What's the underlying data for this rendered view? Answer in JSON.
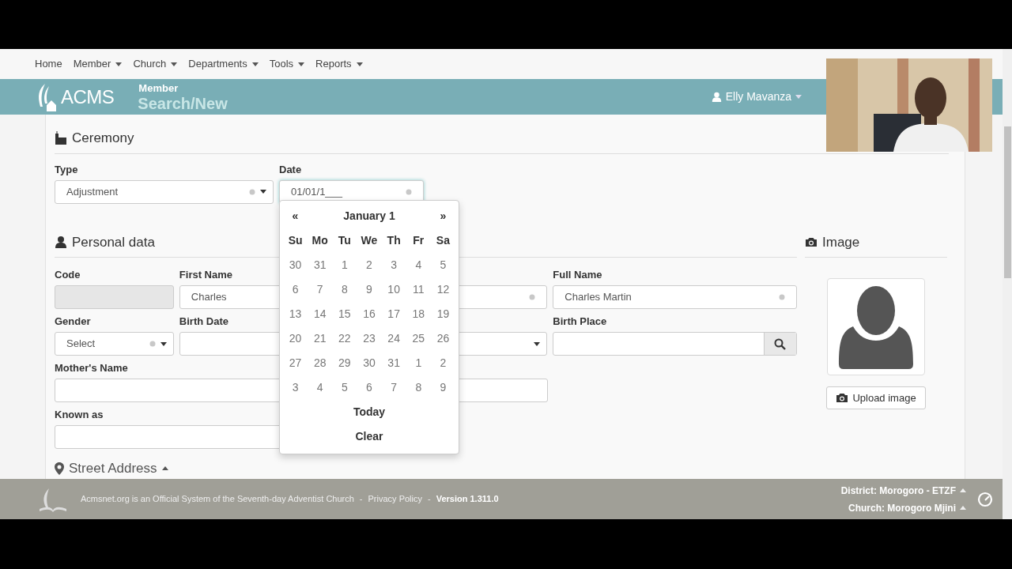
{
  "nav": {
    "items": [
      {
        "label": "Home",
        "dropdown": false
      },
      {
        "label": "Member",
        "dropdown": true
      },
      {
        "label": "Church",
        "dropdown": true
      },
      {
        "label": "Departments",
        "dropdown": true
      },
      {
        "label": "Tools",
        "dropdown": true
      },
      {
        "label": "Reports",
        "dropdown": true
      }
    ]
  },
  "header": {
    "logo_text": "ACMS",
    "section": "Member",
    "title": "Search/New",
    "user": "Elly Mavanza"
  },
  "ceremony": {
    "title": "Ceremony",
    "fields": [
      {
        "label": "Type",
        "kind": "select",
        "value": "Adjustment",
        "required": true,
        "focused": false
      },
      {
        "label": "Date",
        "kind": "text",
        "value": "01/01/1___",
        "required": true,
        "focused": true
      }
    ]
  },
  "datepicker": {
    "title": "January 1",
    "prev": "«",
    "next": "»",
    "weekdays": [
      "Su",
      "Mo",
      "Tu",
      "We",
      "Th",
      "Fr",
      "Sa"
    ],
    "weeks": [
      [
        "30",
        "31",
        "1",
        "2",
        "3",
        "4",
        "5"
      ],
      [
        "6",
        "7",
        "8",
        "9",
        "10",
        "11",
        "12"
      ],
      [
        "13",
        "14",
        "15",
        "16",
        "17",
        "18",
        "19"
      ],
      [
        "20",
        "21",
        "22",
        "23",
        "24",
        "25",
        "26"
      ],
      [
        "27",
        "28",
        "29",
        "30",
        "31",
        "1",
        "2"
      ],
      [
        "3",
        "4",
        "5",
        "6",
        "7",
        "8",
        "9"
      ]
    ],
    "today": "Today",
    "clear": "Clear"
  },
  "personal": {
    "title": "Personal data",
    "rows": [
      [
        {
          "label": "Code",
          "kind": "text",
          "disabled": true,
          "required": false
        },
        {
          "label": "First Name",
          "kind": "text",
          "value": "Charles",
          "disabled": false
        },
        {
          "kind": "text",
          "disabled": false,
          "required": true
        },
        {
          "label": "Full Name",
          "kind": "text",
          "value": "Charles Martin",
          "disabled": false,
          "required": true
        }
      ],
      [
        {
          "label": "Gender",
          "kind": "select",
          "value": "Select",
          "disabled": false,
          "required": true
        },
        {
          "label": "Birth Date",
          "kind": "text",
          "disabled": false
        },
        {
          "kind": "select",
          "disabled": false,
          "required": false
        },
        {
          "label": "Birth Place",
          "kind": "search",
          "disabled": false,
          "required": false
        }
      ],
      [
        {
          "label": "Mother's Name",
          "kind": "text",
          "disabled": false,
          "required": false
        }
      ],
      [
        {
          "label": "Known as",
          "kind": "text",
          "disabled": false
        }
      ]
    ]
  },
  "image": {
    "title": "Image",
    "button": "Upload image"
  },
  "street_address": {
    "title": "Street Address",
    "expanded": true
  },
  "footer": {
    "items": [
      {
        "kind": "text",
        "text": "Acmsnet.org is an Official System of the Seventh-day Adventist Church"
      },
      {
        "kind": "link",
        "text": "Privacy Policy"
      },
      {
        "kind": "version",
        "text": "Version 1.311.0"
      }
    ],
    "separator": "-",
    "district": "District: Morogoro - ETZF",
    "church": "Church: Morogoro Mjini"
  }
}
